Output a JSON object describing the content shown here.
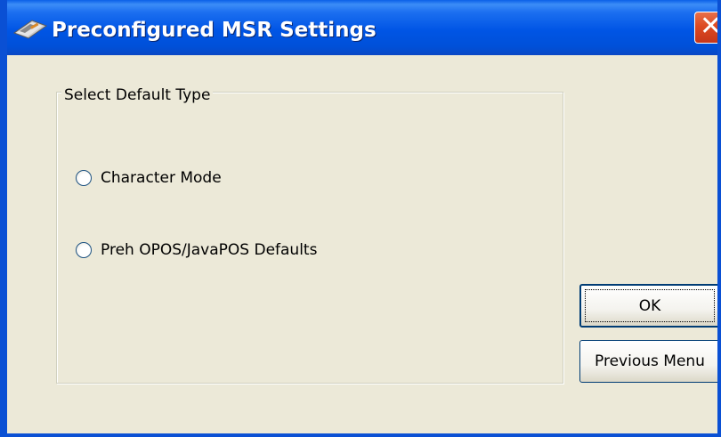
{
  "window": {
    "title": "Preconfigured MSR Settings",
    "icon": "msr-device-icon",
    "close_glyph": "✕"
  },
  "group": {
    "legend": "Select Default Type",
    "options": [
      {
        "label": "Character Mode",
        "selected": false
      },
      {
        "label": "Preh OPOS/JavaPOS Defaults",
        "selected": false
      }
    ]
  },
  "buttons": {
    "ok_label": "OK",
    "previous_label": "Previous Menu"
  },
  "colors": {
    "titlebar": "#0055e5",
    "close_button": "#dd4a22",
    "dialog_background": "#ece9d8"
  }
}
